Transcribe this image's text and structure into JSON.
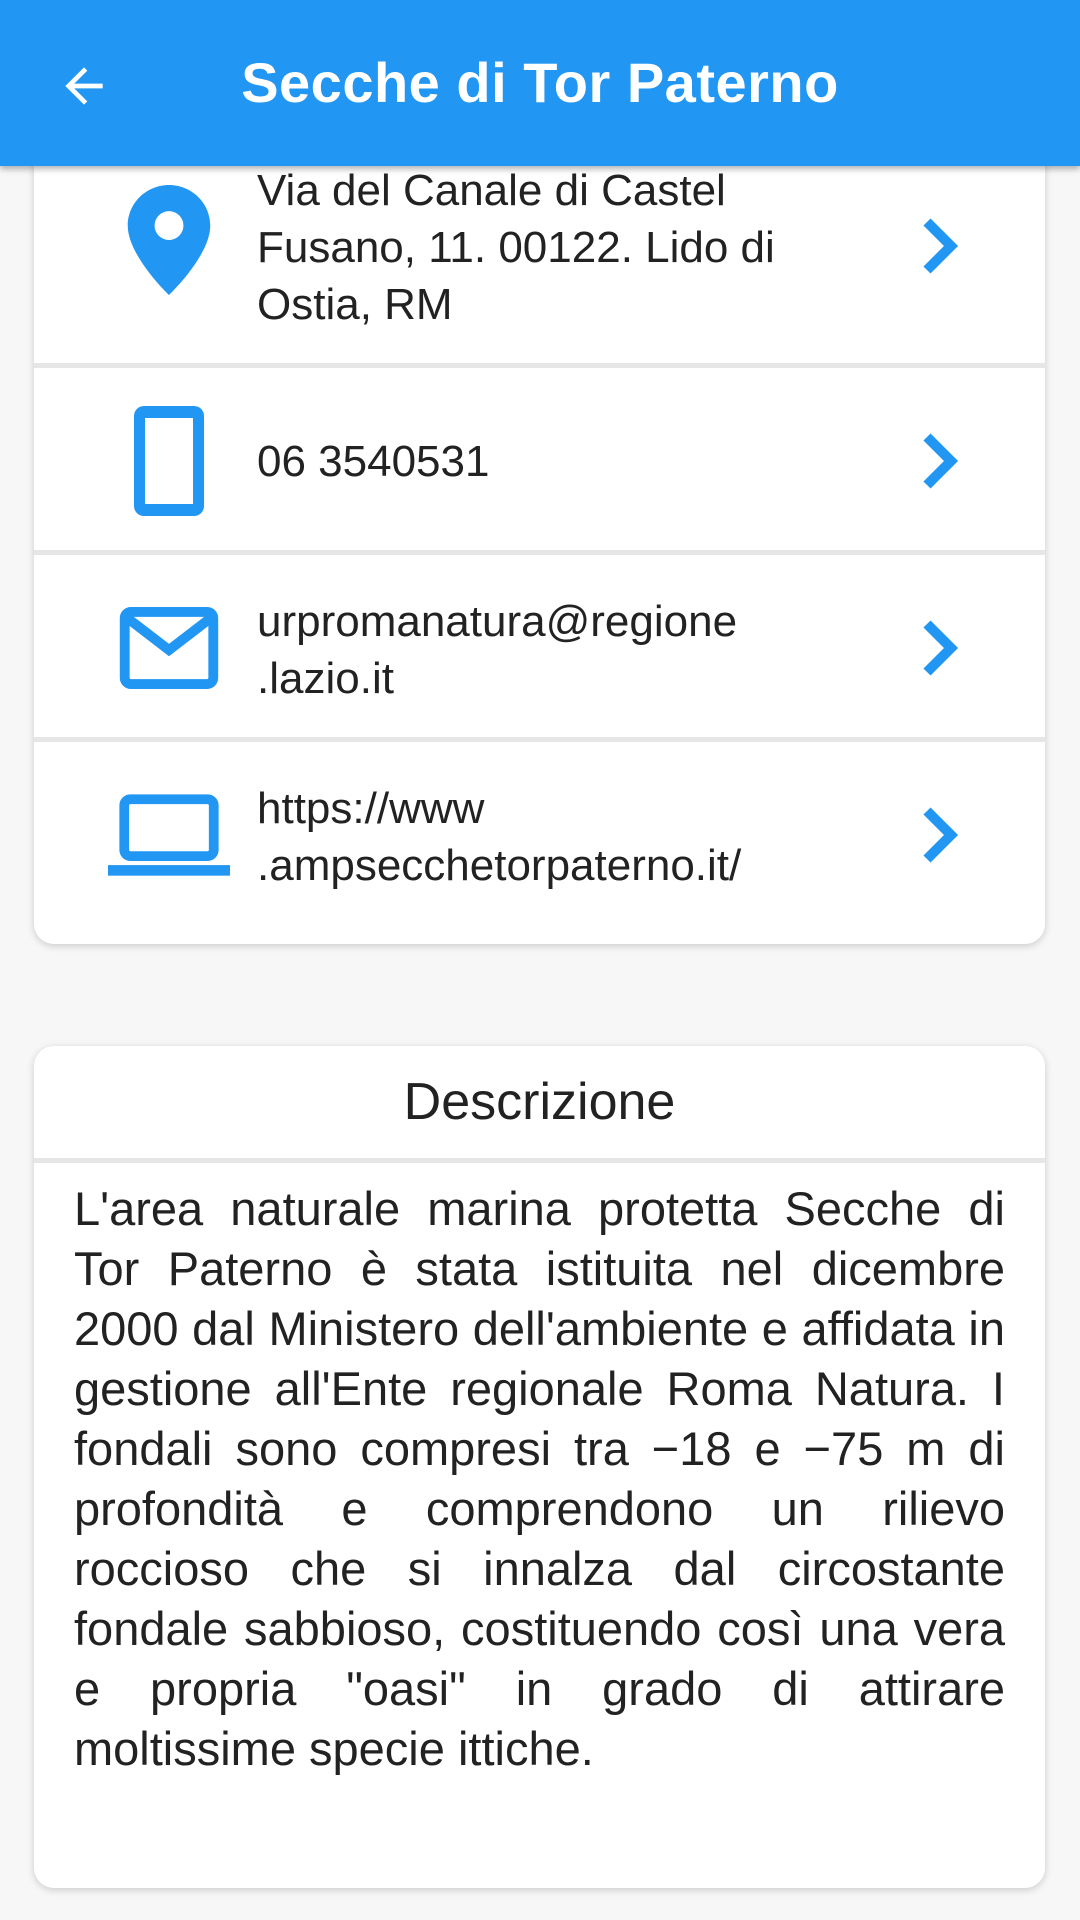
{
  "appbar": {
    "title": "Secche di Tor Paterno",
    "back_icon": "arrow-left-icon"
  },
  "contacts": [
    {
      "icon": "location-pin-icon",
      "text": "Via del Canale di Castel\nFusano, 11. 00122. Lido di\nOstia, RM"
    },
    {
      "icon": "smartphone-icon",
      "text": "06 3540531"
    },
    {
      "icon": "mail-icon",
      "text": "urpromanatura@regione\n.lazio.it"
    },
    {
      "icon": "laptop-icon",
      "text": "https://www\n.ampsecchetorpaterno.it/"
    }
  ],
  "description": {
    "title": "Descrizione",
    "body": "L'area naturale marina protetta Secche di Tor Paterno è stata istituita nel dicembre 2000 dal Ministero dell'ambiente e affidata in gestione all'Ente regionale Roma Natura. I fondali sono compresi tra −18 e −75 m di profondità e comprendono un rilievo roccioso che si innalza dal circostante fondale sabbioso, costituendo così una vera e propria \"oasi\" in grado di attirare moltissime specie ittiche."
  },
  "colors": {
    "accent": "#2196f3",
    "background": "#f7f7f7",
    "card": "#ffffff",
    "divider": "#e6e6e6"
  }
}
